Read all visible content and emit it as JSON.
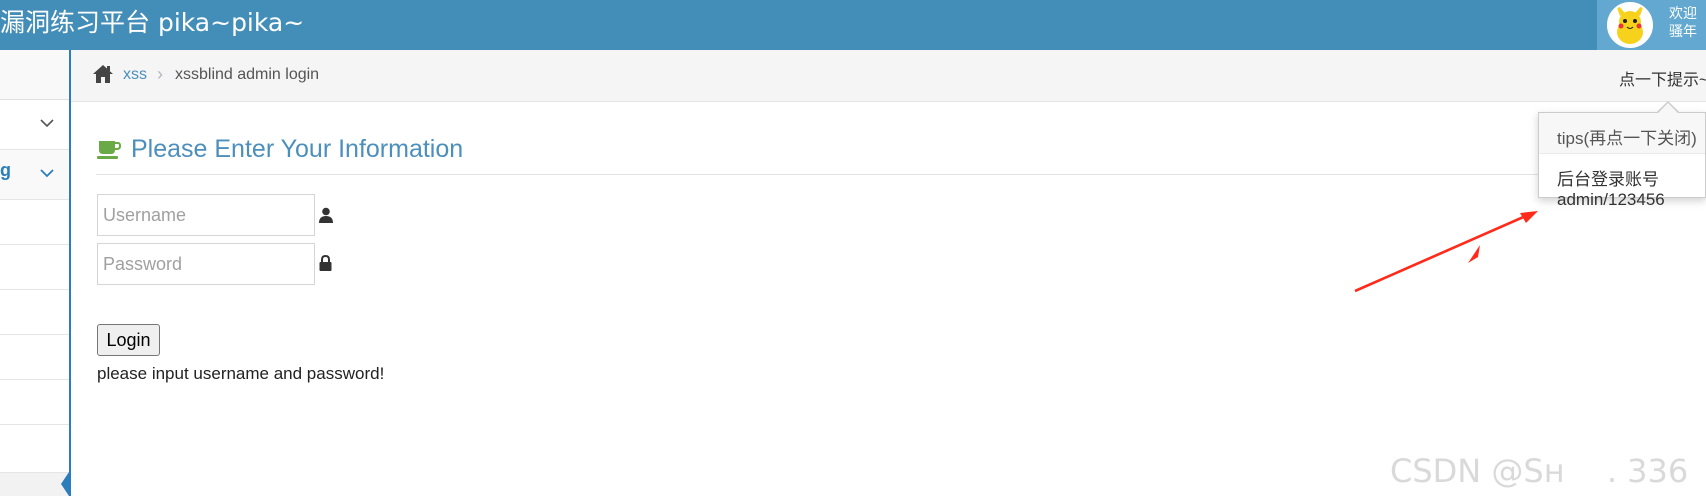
{
  "navbar": {
    "brand": "漏洞练习平台 pika~pika~",
    "welcome_line1": "欢迎",
    "welcome_line2": "骚年"
  },
  "breadcrumb": {
    "home_icon": "home-icon",
    "link": "xss",
    "separator": "›",
    "active": "xssblind admin login",
    "hint_link": "点一下提示~"
  },
  "main": {
    "title": "Please Enter Your Information",
    "title_icon": "coffee-icon",
    "username_placeholder": "Username",
    "password_placeholder": "Password",
    "login_label": "Login",
    "message": "please input username and password!"
  },
  "popover": {
    "title": "tips(再点一下关闭)",
    "line1": "后台登录账号",
    "line2": "admin/123456"
  },
  "sidebar": {
    "partial_label": "g"
  },
  "watermark": "CSDN @Sн 　. 336",
  "colors": {
    "navbar": "#438eb9",
    "accent": "#4c8fbd",
    "annotation": "#ff2a1a"
  }
}
